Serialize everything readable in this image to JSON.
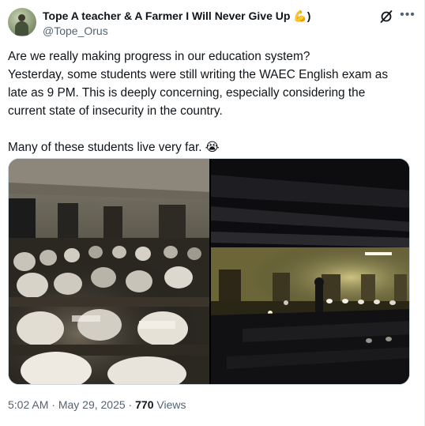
{
  "author": {
    "display_name": "Tope A teacher & A Farmer I Will Never Give Up",
    "name_emoji": "💪",
    "name_suffix": ")",
    "handle": "@Tope_Orus"
  },
  "icons": {
    "grok": "grok-icon",
    "more": "more-options-icon",
    "emoji_crying": "😭"
  },
  "tweet": {
    "lines": [
      "Are we really making progress in our education system?",
      "Yesterday, some students were still writing the WAEC English exam as",
      "late as 9 PM. This is deeply concerning, especially considering the",
      "current state of insecurity in the country.",
      "Many of these students live very far."
    ]
  },
  "meta": {
    "time": "5:02 AM",
    "separator": " · ",
    "date": "May 29, 2025",
    "views_count": "770",
    "views_label": "Views"
  },
  "colors": {
    "text_primary": "#0f1419",
    "text_secondary": "#536471",
    "border": "#cfd9de"
  }
}
